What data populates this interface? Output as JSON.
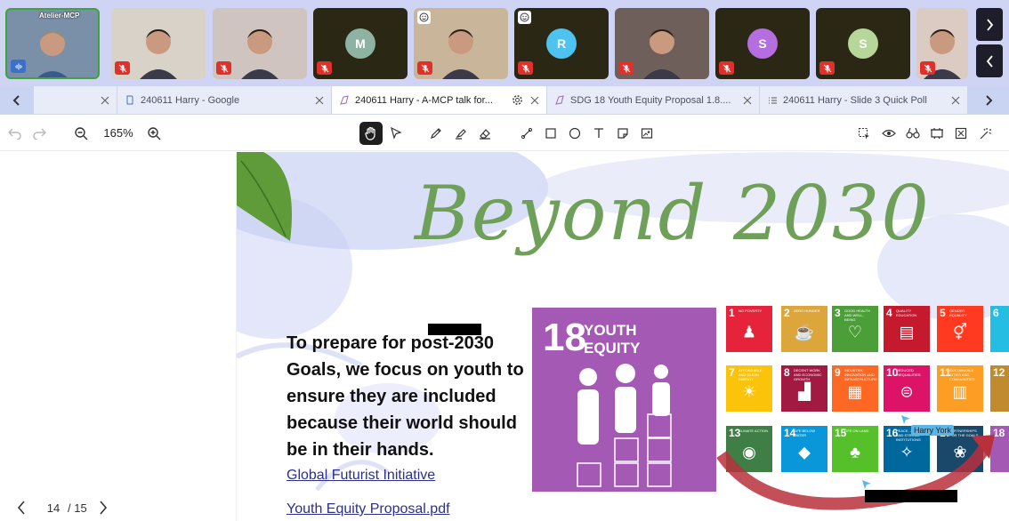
{
  "participants": [
    {
      "name": "Atelier-MCP",
      "initial": "",
      "muted": false,
      "self": true,
      "kind": "video",
      "reaction": false
    },
    {
      "name": "",
      "initial": "",
      "muted": true,
      "kind": "video",
      "reaction": false
    },
    {
      "name": "",
      "initial": "",
      "muted": true,
      "kind": "video",
      "reaction": false
    },
    {
      "name": "",
      "initial": "M",
      "color": "#8fb3a2",
      "muted": true,
      "kind": "avatar",
      "reaction": false
    },
    {
      "name": "",
      "initial": "",
      "muted": true,
      "kind": "video",
      "reaction": true
    },
    {
      "name": "",
      "initial": "R",
      "color": "#4fc3f0",
      "muted": true,
      "kind": "avatar",
      "reaction": true
    },
    {
      "name": "",
      "initial": "",
      "muted": true,
      "kind": "video",
      "reaction": false
    },
    {
      "name": "",
      "initial": "S",
      "color": "#b56ee0",
      "muted": true,
      "kind": "avatar",
      "reaction": false
    },
    {
      "name": "",
      "initial": "S",
      "color": "#b7d79a",
      "muted": true,
      "kind": "avatar",
      "reaction": false
    },
    {
      "name": "",
      "initial": "",
      "muted": true,
      "kind": "video",
      "reaction": false
    }
  ],
  "tabs": [
    {
      "label": "",
      "icon": "blank-icon",
      "active": false
    },
    {
      "label": "240611 Harry - Google",
      "icon": "doc-icon",
      "active": false
    },
    {
      "label": "240611 Harry - A-MCP talk for...",
      "icon": "slides-icon",
      "active": true
    },
    {
      "label": "SDG 18 Youth Equity Proposal 1.8....",
      "icon": "slides-icon",
      "active": false
    },
    {
      "label": "240611 Harry - Slide 3 Quick Poll",
      "icon": "poll-icon",
      "active": false
    }
  ],
  "toolbar": {
    "zoom": "165%"
  },
  "pager": {
    "current": "14",
    "total": "/ 15"
  },
  "slide": {
    "title": "Beyond 2030",
    "body": "To prepare for post-2030 Goals, we focus on youth to ensure they are included because their world should be in their hands.",
    "link1": "Global Futurist Initiative",
    "link2": "Youth Equity Proposal.pdf",
    "youth_number": "18",
    "youth_label": "YOUTH EQUITY",
    "cursor_label": "Harry York",
    "sdgs": [
      {
        "n": "1",
        "t": "NO POVERTY",
        "color": "#e5243b",
        "glyph": "♟"
      },
      {
        "n": "2",
        "t": "ZERO HUNGER",
        "color": "#dda63a",
        "glyph": "☕"
      },
      {
        "n": "3",
        "t": "GOOD HEALTH AND WELL-BEING",
        "color": "#4c9f38",
        "glyph": "♡"
      },
      {
        "n": "4",
        "t": "QUALITY EDUCATION",
        "color": "#c5192d",
        "glyph": "▤"
      },
      {
        "n": "5",
        "t": "GENDER EQUALITY",
        "color": "#ff3a21",
        "glyph": "⚥"
      },
      {
        "n": "6",
        "t": "",
        "color": "#26bde2",
        "glyph": ""
      },
      {
        "n": "7",
        "t": "AFFORDABLE AND CLEAN ENERGY",
        "color": "#fcc30b",
        "glyph": "☀"
      },
      {
        "n": "8",
        "t": "DECENT WORK AND ECONOMIC GROWTH",
        "color": "#a21942",
        "glyph": "▟"
      },
      {
        "n": "9",
        "t": "INDUSTRY, INNOVATION AND INFRASTRUCTURE",
        "color": "#fd6925",
        "glyph": "▦"
      },
      {
        "n": "10",
        "t": "REDUCED INEQUALITIES",
        "color": "#dd1367",
        "glyph": "⊜"
      },
      {
        "n": "11",
        "t": "SUSTAINABLE CITIES AND COMMUNITIES",
        "color": "#fd9d24",
        "glyph": "▥"
      },
      {
        "n": "12",
        "t": "",
        "color": "#bf8b2e",
        "glyph": ""
      },
      {
        "n": "13",
        "t": "CLIMATE ACTION",
        "color": "#3f7e44",
        "glyph": "◉"
      },
      {
        "n": "14",
        "t": "LIFE BELOW WATER",
        "color": "#0a97d9",
        "glyph": "◆"
      },
      {
        "n": "15",
        "t": "LIFE ON LAND",
        "color": "#56c02b",
        "glyph": "♣"
      },
      {
        "n": "16",
        "t": "PEACE, JUSTICE AND STRONG INSTITUTIONS",
        "color": "#00689d",
        "glyph": "✧"
      },
      {
        "n": "17",
        "t": "PARTNERSHIPS FOR THE GOALS",
        "color": "#19486a",
        "glyph": "❀"
      },
      {
        "n": "18",
        "t": "",
        "color": "#a45ab5",
        "glyph": ""
      }
    ]
  },
  "colors": {
    "accent": "#3b72c8",
    "strip": "#cfd4f5",
    "muted": "#e0302a"
  }
}
